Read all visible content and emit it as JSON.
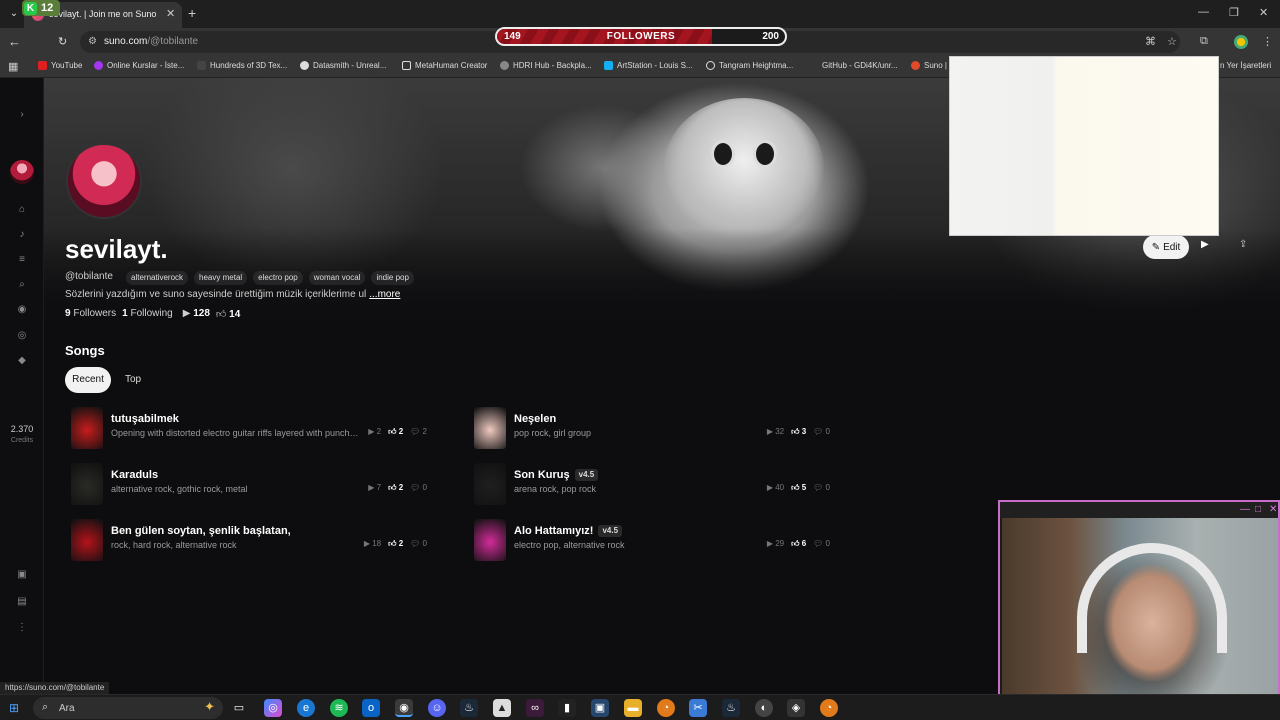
{
  "browser": {
    "tab_title": "sevilayt. | Join me on Suno",
    "url_host": "suno.com",
    "url_path": "/@tobilante",
    "status_url": "https://suno.com/@tobilante",
    "extension_count": "12",
    "extension_letter": "K",
    "bookmarks": [
      "YouTube",
      "Online Kurslar - İste...",
      "Hundreds of 3D Tex...",
      "Datasmith - Unreal...",
      "MetaHuman Creator",
      "HDRI Hub - Backpla...",
      "ArtStation - Louis S...",
      "Tangram Heightma...",
      "GitHub - GDi4K/unr...",
      "Suno |",
      "n Yer İşaretleri"
    ]
  },
  "stream_overlay": {
    "followers_current": "149",
    "followers_label": "FOLLOWERS",
    "followers_goal": "200",
    "followers_progress": 0.745
  },
  "rail": {
    "credits_value": "2.370",
    "credits_label": "Credits"
  },
  "profile": {
    "display_name": "sevilayt.",
    "handle": "@tobilante",
    "tags": [
      "alternativerock",
      "heavy metal",
      "electro pop",
      "woman vocal",
      "indie pop"
    ],
    "bio": "Sözlerini yazdığım ve suno sayesinde ürettiğim müzik içeriklerime ul",
    "bio_more": "...more",
    "followers_count": "9",
    "followers_label": "Followers",
    "following_count": "1",
    "following_label": "Following",
    "plays": "128",
    "likes": "14",
    "edit_label": "Edit"
  },
  "songs": {
    "heading": "Songs",
    "tab_recent": "Recent",
    "tab_top": "Top",
    "items": [
      {
        "title": "tutuşabilmek",
        "version": "",
        "genre": "Opening with distorted electro guitar riffs layered with punchy ...",
        "plays": "2",
        "likes": "2",
        "comments": "2",
        "color": "#c81c1c"
      },
      {
        "title": "Neşelen",
        "version": "",
        "genre": "pop rock, girl group",
        "plays": "32",
        "likes": "3",
        "comments": "0",
        "color": "#f0c9c0"
      },
      {
        "title": "Karaduls",
        "version": "",
        "genre": "alternative rock, gothic rock, metal",
        "plays": "7",
        "likes": "2",
        "comments": "0",
        "color": "#2a2a26"
      },
      {
        "title": "Son Kuruş",
        "version": "v4.5",
        "genre": "arena rock, pop rock",
        "plays": "40",
        "likes": "5",
        "comments": "0",
        "color": "#1f1f1f"
      },
      {
        "title": "Ben gülen soytan, şenlik başlatan,",
        "version": "",
        "genre": "rock, hard rock, alternative rock",
        "plays": "18",
        "likes": "2",
        "comments": "0",
        "color": "#b5121b"
      },
      {
        "title": "Alo Hattamıyız!",
        "version": "v4.5",
        "genre": "electro pop, alternative rock",
        "plays": "29",
        "likes": "6",
        "comments": "0",
        "color": "#d22c9a"
      }
    ]
  },
  "taskbar": {
    "search_placeholder": "Ara"
  }
}
